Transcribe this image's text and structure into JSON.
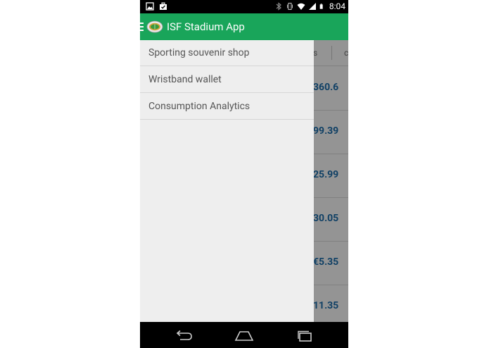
{
  "status_bar": {
    "time": "8:04",
    "left_icons": [
      "image-icon",
      "briefcase-icon"
    ],
    "right_icons": [
      "bluetooth-icon",
      "vibrate-icon",
      "wifi-icon",
      "signal-icon",
      "battery-icon"
    ]
  },
  "app_bar": {
    "title": "ISF Stadium App",
    "logo_icon": "stadium-logo-icon",
    "menu_icon": "hamburger-menu-icon",
    "color": "#19a55a"
  },
  "drawer": {
    "items": [
      {
        "label": "Sporting souvenir shop"
      },
      {
        "label": "Wristband wallet"
      },
      {
        "label": "Consumption Analytics"
      }
    ]
  },
  "background": {
    "header_cols": [
      "s",
      "c"
    ],
    "amounts": [
      "360.6",
      "99.39",
      "25.99",
      "30.05",
      "€5.35",
      "11.35"
    ],
    "amount_color": "#1c6fae"
  },
  "nav_bar": {
    "buttons": [
      "back-icon",
      "home-icon",
      "recents-icon"
    ]
  }
}
